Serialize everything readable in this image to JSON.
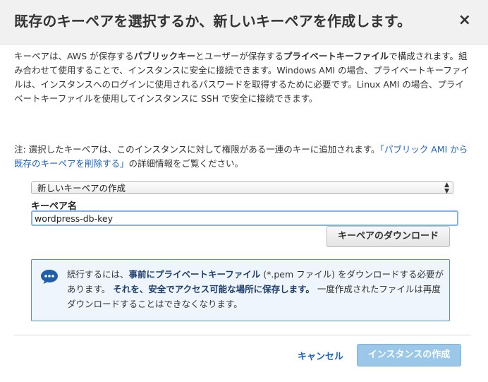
{
  "dialog": {
    "title": "既存のキーペアを選択するか、新しいキーペアを作成します。",
    "close_glyph": "×"
  },
  "description": {
    "p1_a": "キーペアは、AWS が保存する",
    "p1_b": "パブリックキー",
    "p1_c": "とユーザーが保存する",
    "p1_d": "プライベートキーファイル",
    "p1_e": "で構成されます。組み合わせて使用することで、インスタンスに安全に接続できます。Windows AMI の場合、プライベートキーファイルは、インスタンスへのログインに使用されるパスワードを取得するために必要です。Linux AMI の場合、プライベートキーファイルを使用してインスタンスに SSH で安全に接続できます。"
  },
  "note": {
    "prefix": "注: 選択したキーペアは、このインスタンスに対して権限がある一連のキーに追加されます。",
    "link": "「パブリック AMI から既存のキーペアを削除する」",
    "suffix": "の詳細情報をご覧ください。"
  },
  "keypair_select": {
    "selected": "新しいキーペアの作成"
  },
  "keypair_name": {
    "label": "キーペア名",
    "value": "wordpress-db-key"
  },
  "download_button": "キーペアのダウンロード",
  "info": {
    "t1": "続行するには、",
    "t2": "事前にプライベートキーファイル",
    "t3": " (*.pem ファイル) をダウンロードする必要があります。",
    "t4": "それを、安全でアクセス可能な場所に保存します。",
    "t5": "一度作成されたファイルは再度ダウンロードすることはできなくなります。",
    "icon": "chat-bubble-icon",
    "color": "#1f5fa8"
  },
  "footer": {
    "cancel": "キャンセル",
    "create": "インスタンスの作成"
  }
}
